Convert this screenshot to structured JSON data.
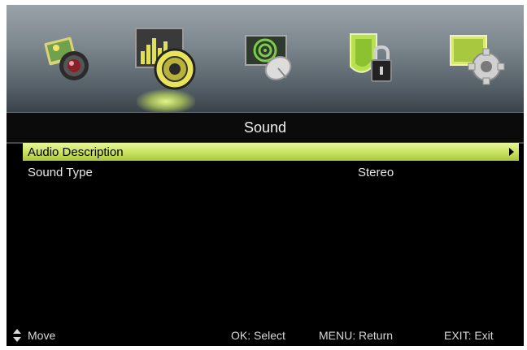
{
  "tabs": [
    {
      "name": "picture",
      "icon": "picture-camera-icon",
      "selected": false
    },
    {
      "name": "sound",
      "icon": "sound-speaker-icon",
      "selected": true
    },
    {
      "name": "channel",
      "icon": "channel-satellite-icon",
      "selected": false
    },
    {
      "name": "lock",
      "icon": "lock-shield-icon",
      "selected": false
    },
    {
      "name": "setup",
      "icon": "setup-gear-icon",
      "selected": false
    }
  ],
  "menu": {
    "title": "Sound",
    "items": [
      {
        "label": "Audio Description",
        "value": "",
        "selected": true
      },
      {
        "label": "Sound Type",
        "value": "Stereo",
        "selected": false
      }
    ]
  },
  "footer": {
    "move": "Move",
    "select": "OK: Select",
    "return": "MENU: Return",
    "exit": "EXIT: Exit"
  },
  "colors": {
    "highlight": "#d4ec6e",
    "background": "#000000",
    "text": "#e8e8e8"
  }
}
